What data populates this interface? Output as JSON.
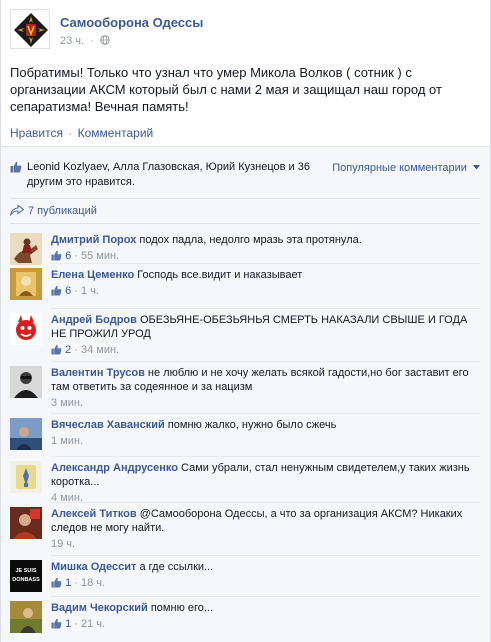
{
  "post": {
    "page_name": "Самооборона Одессы",
    "time": "23 ч.",
    "text": "Побратимы! Только что узнал что умер Микола Волков ( сотник ) с организации АКСМ который был с нами 2 мая и защищал наш город от сепаратизма! Вечная память!",
    "like_label": "Нравится",
    "comment_label": "Комментарий"
  },
  "feedback": {
    "likes_text": "Leonid Kozlyaev, Алла Глазовская, Юрий Кузнецов и 36 другим это нравится.",
    "popular_label": "Популярные комментарии",
    "shares_label": "7 публикаций"
  },
  "comments": [
    {
      "author": "Дмитрий Порох",
      "text": "подох падла, недолго мразь эта протянула.",
      "likes": "6",
      "time": "55 мин.",
      "avatar": "rider"
    },
    {
      "author": "Елена Цеменко",
      "text": "Господь все.видит и наказывает",
      "likes": "6",
      "time": "1 ч.",
      "avatar": "gold"
    },
    {
      "author": "Андрей Бодров",
      "text": "ОБЕЗЬЯНЕ-ОБЕЗЬЯНЬЯ СМЕРТЬ НАКАЗАЛИ СВЫШЕ И ГОДА НЕ ПРОЖИЛ УРОД",
      "likes": "2",
      "time": "34 мин.",
      "avatar": "devil"
    },
    {
      "author": "Валентин Трусов",
      "text": "не люблю и не хочу желать всякой гадости,но бог заставит его там ответить за содеянное и за нацизм",
      "likes": "",
      "time": "3 мин.",
      "avatar": "man"
    },
    {
      "author": "Вячеслав Хаванский",
      "text": "помню жалко, нужно было сжечь",
      "likes": "",
      "time": "1 мин.",
      "avatar": "blue"
    },
    {
      "author": "Александр Андрусенко",
      "text": "Сами убрали, стал ненужным свидетелем,у таких жизнь коротка...",
      "likes": "",
      "time": "4 мин.",
      "avatar": "ukr"
    },
    {
      "author": "Алексей Титков",
      "text": "@Самооборона Одессы, а что за организация АКСМ? Никаких следов не могу найти.",
      "likes": "",
      "time": "19 ч.",
      "avatar": "red"
    },
    {
      "author": "Мишка Одессит",
      "text": "а где ссылки...",
      "likes": "1",
      "time": "18 ч.",
      "avatar": "donbass",
      "avatar_text": "JE SUIS DONBASS"
    },
    {
      "author": "Вадим Чекорский",
      "text": "помню его...",
      "likes": "1",
      "time": "21 ч.",
      "avatar": "yellow"
    }
  ],
  "colors": {
    "link": "#3b5998",
    "meta": "#9197a3",
    "bg": "#f6f7f9"
  }
}
